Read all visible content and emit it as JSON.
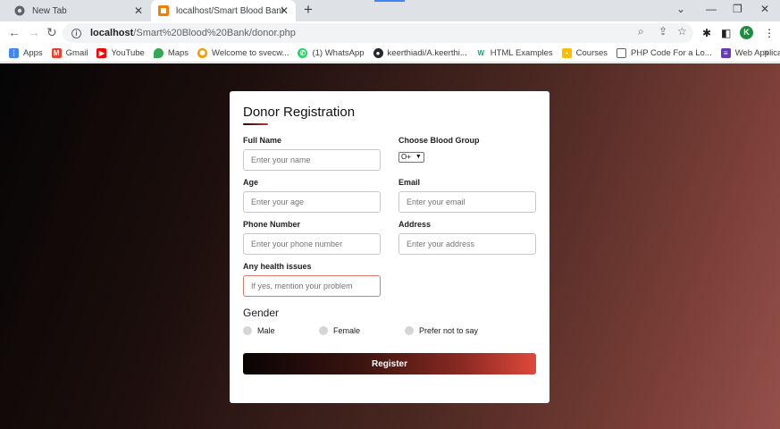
{
  "browser": {
    "tabs": [
      {
        "title": "New Tab"
      },
      {
        "title": "localhost/Smart Blood Bank/donor"
      }
    ],
    "new_tab_label": "+",
    "url_host": "localhost",
    "url_path": "/Smart%20Blood%20Bank/donor.php",
    "profile_initial": "K",
    "bookmarks": [
      {
        "label": "Apps",
        "icon": "apps-grid-icon",
        "color": "#4285f4"
      },
      {
        "label": "Gmail",
        "icon": "gmail-icon",
        "color": "#ea4335"
      },
      {
        "label": "YouTube",
        "icon": "youtube-icon",
        "color": "#ff0000"
      },
      {
        "label": "Maps",
        "icon": "maps-icon",
        "color": "#34a853"
      },
      {
        "label": "Welcome to svecw...",
        "icon": "svecw-icon",
        "color": "#f29900"
      },
      {
        "label": "(1) WhatsApp",
        "icon": "whatsapp-icon",
        "color": "#25d366"
      },
      {
        "label": "keerthiadi/A.keerthi...",
        "icon": "github-icon",
        "color": "#24292e"
      },
      {
        "label": "HTML Examples",
        "icon": "w3schools-icon",
        "color": "#04aa6d"
      },
      {
        "label": "Courses",
        "icon": "courses-icon",
        "color": "#fbbc04"
      },
      {
        "label": "PHP Code For a Lo...",
        "icon": "php-icon",
        "color": "#5f6368"
      },
      {
        "label": "Web Application D...",
        "icon": "webapp-icon",
        "color": "#673ab7"
      }
    ],
    "bookmarks_more": "»"
  },
  "form": {
    "title": "Donor Registration",
    "fields": {
      "full_name": {
        "label": "Full Name",
        "placeholder": "Enter your name"
      },
      "blood_group": {
        "label": "Choose Blood Group",
        "value": "O+"
      },
      "age": {
        "label": "Age",
        "placeholder": "Enter your age"
      },
      "email": {
        "label": "Email",
        "placeholder": "Enter your email"
      },
      "phone": {
        "label": "Phone Number",
        "placeholder": "Enter your phone number"
      },
      "address": {
        "label": "Address",
        "placeholder": "Enter your address"
      },
      "health": {
        "label": "Any health issues",
        "placeholder": "If yes, mention your problem"
      }
    },
    "gender": {
      "title": "Gender",
      "options": [
        "Male",
        "Female",
        "Prefer not to say"
      ]
    },
    "submit_label": "Register"
  },
  "colors": {
    "accent": "#e0483c",
    "dark": "#0a0404"
  }
}
